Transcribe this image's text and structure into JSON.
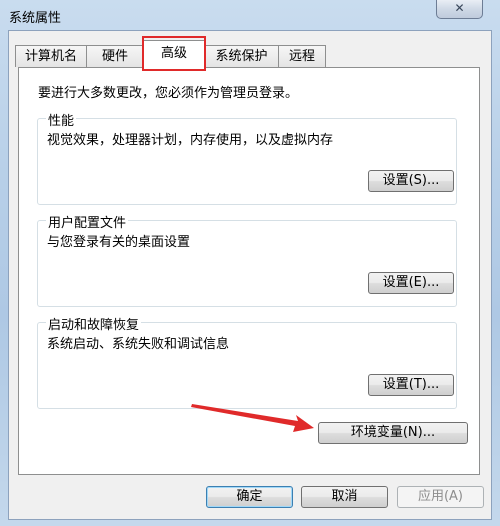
{
  "window": {
    "title": "系统属性",
    "close_glyph": "✕"
  },
  "tabs": [
    {
      "label": "计算机名"
    },
    {
      "label": "硬件"
    },
    {
      "label": "高级",
      "active": true
    },
    {
      "label": "系统保护"
    },
    {
      "label": "远程"
    }
  ],
  "panel": {
    "admin_note": "要进行大多数更改，您必须作为管理员登录。",
    "groups": [
      {
        "title": "性能",
        "description": "视觉效果，处理器计划，内存使用，以及虚拟内存",
        "button": "设置(S)..."
      },
      {
        "title": "用户配置文件",
        "description": "与您登录有关的桌面设置",
        "button": "设置(E)..."
      },
      {
        "title": "启动和故障恢复",
        "description": "系统启动、系统失败和调试信息",
        "button": "设置(T)..."
      }
    ],
    "env_button": "环境变量(N)..."
  },
  "footer": {
    "ok": "确定",
    "cancel": "取消",
    "apply": "应用(A)"
  },
  "annotation_colors": {
    "highlight": "#e02a2a"
  }
}
